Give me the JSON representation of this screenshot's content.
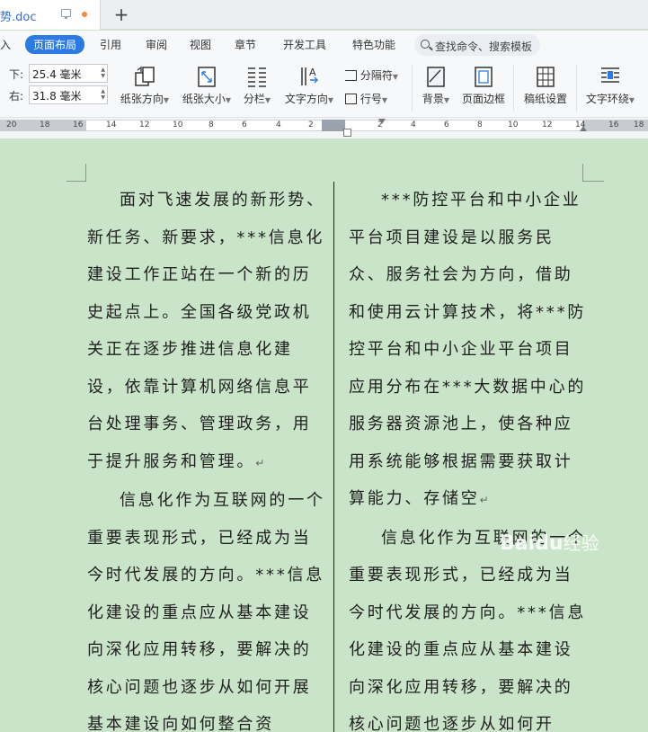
{
  "window": {
    "doc_tab_title": "势.doc"
  },
  "menu": {
    "items": [
      "入",
      "页面布局",
      "引用",
      "审阅",
      "视图",
      "章节",
      "开发工具",
      "特色功能"
    ],
    "active_index": 1,
    "search_label": "查找命令、搜索模板"
  },
  "ribbon": {
    "margin_bottom_label": "下:",
    "margin_bottom_value": "25.4 毫米",
    "margin_right_label": "右:",
    "margin_right_value": "31.8 毫米",
    "orientation_label": "纸张方向",
    "size_label": "纸张大小",
    "columns_label": "分栏",
    "text_direction_label": "文字方向",
    "separator_label": "分隔符",
    "line_number_label": "行号",
    "background_label": "背景",
    "page_border_label": "页面边框",
    "manuscript_label": "稿纸设置",
    "text_wrap_label": "文字环绕"
  },
  "ruler": {
    "labels": [
      "20",
      "18",
      "16",
      "14",
      "12",
      "10",
      "8",
      "6",
      "4",
      "2",
      "2",
      "4",
      "6",
      "8",
      "10",
      "12",
      "14",
      "16",
      "18"
    ]
  },
  "document": {
    "left_column": [
      "面对飞速发展的新形势、新任务、新要求，***信息化建设工作正站在一个新的历史起点上。全国各级党政机关正在逐步推进信息化建设，依靠计算机网络信息平台处理事务、管理政务，用于提升服务和管理。",
      "信息化作为互联网的一个重要表现形式，已经成为当今时代发展的方向。***信息化建设的重点应从基本建设向深化应用转移，要解决的核心问题也逐步从如何开展基本建设向如何整合资"
    ],
    "right_column": [
      "***防控平台和中小企业平台项目建设是以服务民众、服务社会为方向，借助和使用云计算技术，将***防控平台和中小企业平台项目应用分布在***大数据中心的服务器资源池上，使各种应用系统能够根据需要获取计算能力、存储空",
      "信息化作为互联网的一个重要表现形式，已经成为当今时代发展的方向。***信息化建设的重点应从基本建设向深化应用转移，要解决的核心问题也逐步从如何开"
    ],
    "paragraph_mark": "↵"
  },
  "watermark": {
    "brand": "Baidu",
    "suffix": "经验"
  }
}
